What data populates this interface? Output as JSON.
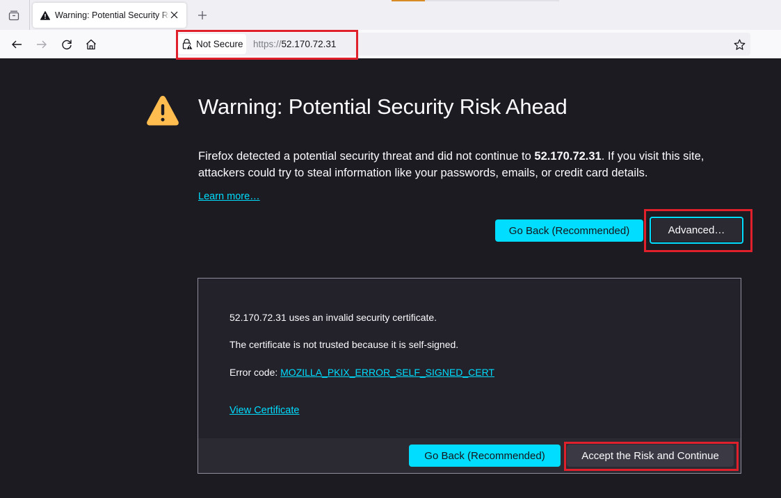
{
  "browser": {
    "page_load_progress": 0.2,
    "tab": {
      "title": "Warning: Potential Security Risk Ahead",
      "icon": "warning-triangle-icon"
    },
    "toolbar": {
      "back_icon": "arrow-left-icon",
      "forward_icon": "arrow-right-icon",
      "reload_icon": "reload-icon",
      "home_icon": "home-icon",
      "new_tab_icon": "plus-icon",
      "tab_list_icon": "tab-list-icon",
      "bookmark_icon": "star-icon"
    },
    "urlbar": {
      "security_label": "Not Secure",
      "security_icon": "insecure-lock-icon",
      "scheme": "https://",
      "host": "52.170.72.31"
    }
  },
  "page": {
    "title": "Warning: Potential Security Risk Ahead",
    "description_before": "Firefox detected a potential security threat and did not continue to ",
    "description_host": "52.170.72.31",
    "description_after": ". If you visit this site, attackers could try to steal information like your passwords, emails, or credit card details.",
    "learn_more": "Learn more…",
    "go_back_label": "Go Back (Recommended)",
    "advanced_label": "Advanced…",
    "advanced_panel": {
      "line1": "52.170.72.31 uses an invalid security certificate.",
      "line2": "The certificate is not trusted because it is self-signed.",
      "error_code_label": "Error code: ",
      "error_code": "MOZILLA_PKIX_ERROR_SELF_SIGNED_CERT",
      "view_certificate": "View Certificate",
      "go_back_label": "Go Back (Recommended)",
      "accept_label": "Accept the Risk and Continue"
    }
  },
  "colors": {
    "accent": "#00ddff",
    "warning": "#ffbd4f",
    "page_bg": "#1c1b22",
    "annotation": "#e0202a"
  }
}
